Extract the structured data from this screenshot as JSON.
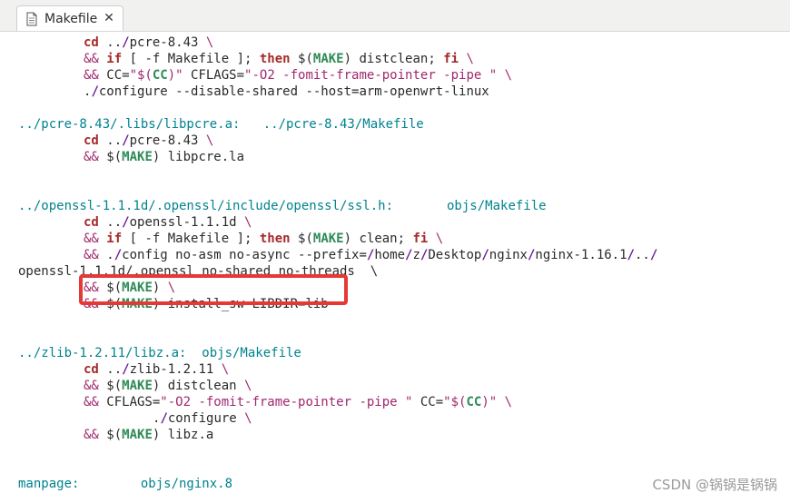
{
  "tab": {
    "title": "Makefile",
    "close_label": "✕"
  },
  "lines": {
    "l0": "../pcre-8.43/.libs/libpcre.a:   ../pcre-8.43/Makefile",
    "l1": "../openssl-1.1.1d/.openssl/include/openssl/ssl.h:       objs/Makefile",
    "l2": "openssl-1.1.1d/.openssl no-shared no-threads  \\",
    "l3": "../zlib-1.2.11/libz.a:  objs/Makefile",
    "l4": "manpage:        objs/nginx.8"
  },
  "watermark": "CSDN @锅锅是锅锅"
}
